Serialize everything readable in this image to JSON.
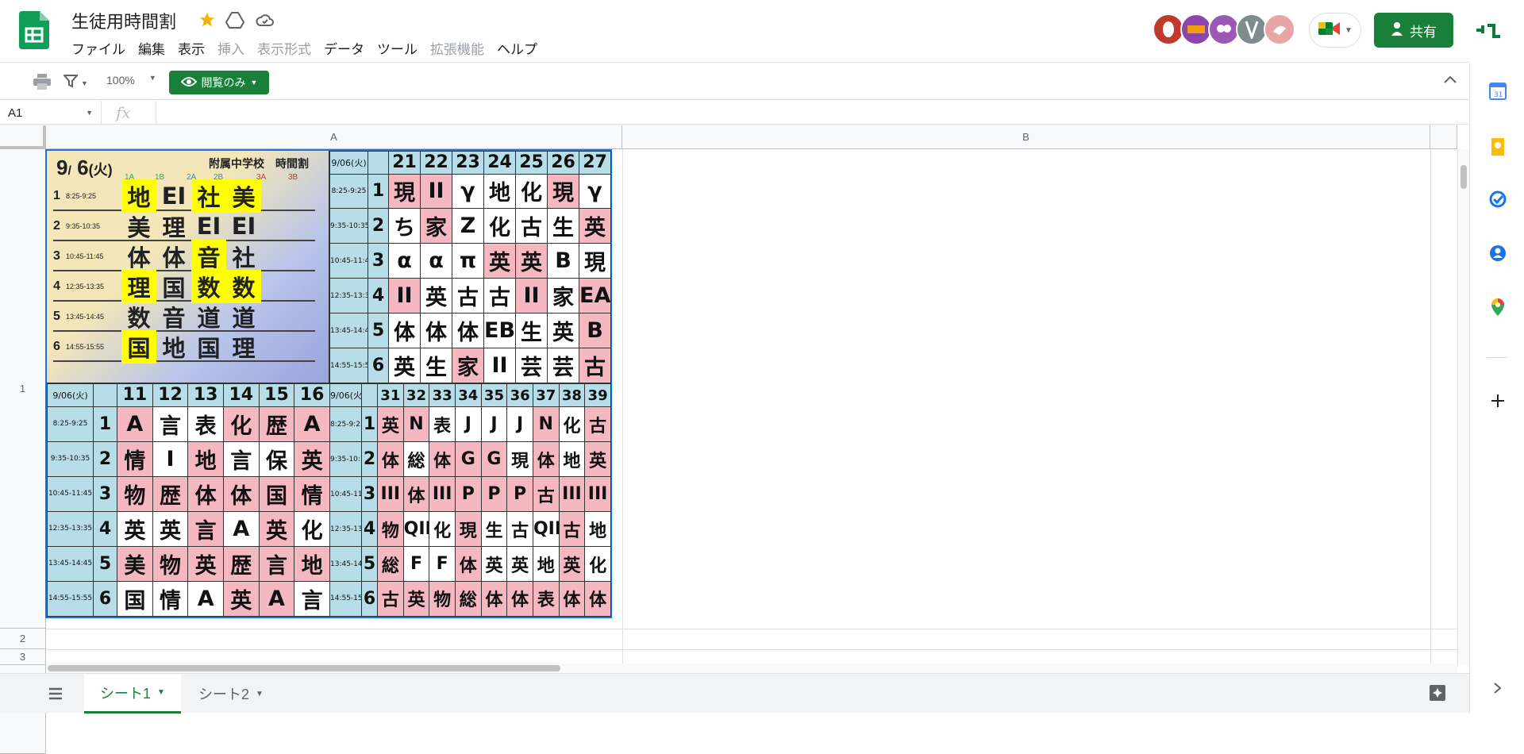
{
  "app": {
    "title": "生徒用時間割",
    "menus": [
      "ファイル",
      "編集",
      "表示",
      "挿入",
      "表示形式",
      "データ",
      "ツール",
      "拡張機能",
      "ヘルプ"
    ],
    "disabled_menus": [
      "挿入",
      "表示形式",
      "拡張機能"
    ],
    "share_label": "共有"
  },
  "toolbar": {
    "zoom": "100%",
    "view_only": "閲覧のみ"
  },
  "formula": {
    "cell": "A1",
    "fx": "fx"
  },
  "columns": [
    "A",
    "B"
  ],
  "rows": [
    "1",
    "2",
    "3"
  ],
  "sheets": [
    "シート1",
    "シート2"
  ],
  "flyer": {
    "date_month": "9",
    "date_day": "6",
    "weekday": "(火)",
    "school": "附属中学校　時間割",
    "classes": [
      "1A",
      "1B",
      "2A",
      "2B",
      "3A",
      "3B"
    ],
    "rows": [
      {
        "p": "1",
        "t": "8:25-9:25",
        "s": [
          "地",
          "EI",
          "社",
          "美"
        ]
      },
      {
        "p": "2",
        "t": "9:35-10:35",
        "s": [
          "美",
          "理",
          "EI",
          "EI"
        ]
      },
      {
        "p": "3",
        "t": "10:45-11:45",
        "s": [
          "体",
          "体",
          "音",
          "社"
        ]
      },
      {
        "p": "4",
        "t": "12:35-13:35",
        "s": [
          "理",
          "国",
          "数",
          "数"
        ]
      },
      {
        "p": "5",
        "t": "13:45-14:45",
        "s": [
          "数",
          "音",
          "道",
          "道"
        ]
      },
      {
        "p": "6",
        "t": "14:55-15:55",
        "s": [
          "国",
          "地",
          "国",
          "理"
        ]
      }
    ]
  },
  "times": [
    "8:25-9:25",
    "9:35-10:35",
    "10:45-11:45",
    "12:35-13:35",
    "13:45-14:45",
    "14:55-15:55"
  ],
  "date_label": "9/06(火)",
  "tableB": {
    "classes": [
      "21",
      "22",
      "23",
      "24",
      "25",
      "26",
      "27"
    ],
    "rows": [
      [
        "現",
        "II",
        "γ",
        "地",
        "化",
        "現",
        "γ"
      ],
      [
        "ち",
        "家",
        "Z",
        "化",
        "古",
        "生",
        "英"
      ],
      [
        "α",
        "α",
        "π",
        "英",
        "英",
        "B",
        "現"
      ],
      [
        "II",
        "英",
        "古",
        "古",
        "II",
        "家",
        "EA"
      ],
      [
        "体",
        "体",
        "体",
        "EB",
        "生",
        "英",
        "B"
      ],
      [
        "英",
        "生",
        "家",
        "II",
        "芸",
        "芸",
        "古"
      ]
    ]
  },
  "tableC": {
    "classes": [
      "11",
      "12",
      "13",
      "14",
      "15",
      "16"
    ],
    "rows": [
      [
        "A",
        "言",
        "表",
        "化",
        "歴",
        "A"
      ],
      [
        "情",
        "I",
        "地",
        "言",
        "保",
        "英"
      ],
      [
        "物",
        "歴",
        "体",
        "体",
        "国",
        "情"
      ],
      [
        "英",
        "英",
        "言",
        "A",
        "英",
        "化"
      ],
      [
        "美",
        "物",
        "英",
        "歴",
        "言",
        "地"
      ],
      [
        "国",
        "情",
        "A",
        "英",
        "A",
        "言"
      ]
    ]
  },
  "tableD": {
    "classes": [
      "31",
      "32",
      "33",
      "34",
      "35",
      "36",
      "37",
      "38",
      "39"
    ],
    "rows": [
      [
        "英",
        "N",
        "表",
        "J",
        "J",
        "J",
        "N",
        "化",
        "古"
      ],
      [
        "体",
        "総",
        "体",
        "G",
        "G",
        "現",
        "体",
        "地",
        "英"
      ],
      [
        "III",
        "体",
        "III",
        "P",
        "P",
        "P",
        "古",
        "III",
        "III"
      ],
      [
        "物",
        "QIII",
        "化",
        "現",
        "生",
        "古",
        "QIII",
        "古",
        "地"
      ],
      [
        "総",
        "F",
        "F",
        "体",
        "英",
        "英",
        "地",
        "英",
        "化"
      ],
      [
        "古",
        "英",
        "物",
        "総",
        "体",
        "体",
        "表",
        "体",
        "体"
      ]
    ]
  }
}
